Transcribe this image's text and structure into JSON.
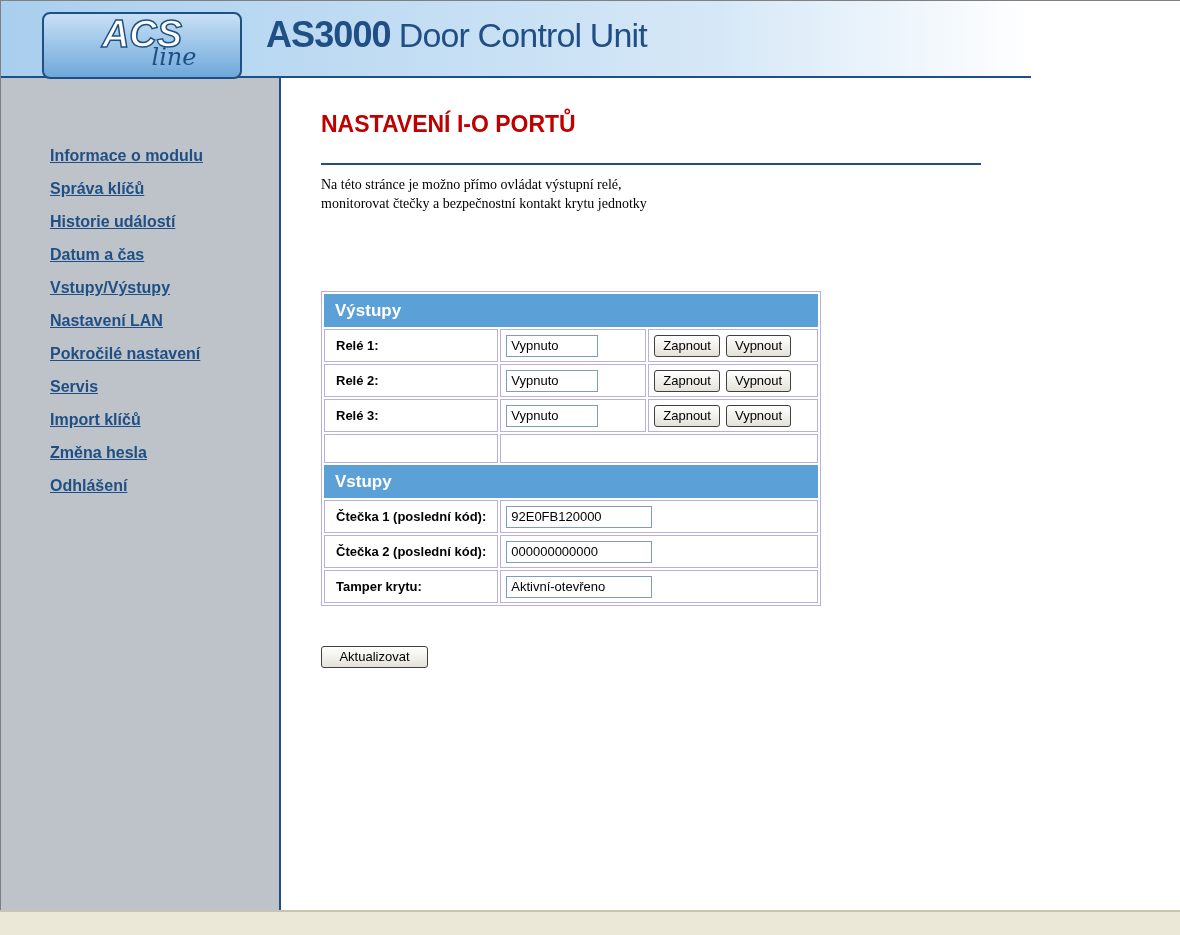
{
  "logo": {
    "main": "ACS",
    "script": "line"
  },
  "header": {
    "model": "AS3000",
    "title": "Door Control Unit"
  },
  "sidebar": {
    "items": [
      {
        "label": "Informace o modulu"
      },
      {
        "label": "Správa klíčů"
      },
      {
        "label": "Historie událostí"
      },
      {
        "label": "Datum a čas"
      },
      {
        "label": "Vstupy/Výstupy"
      },
      {
        "label": "Nastavení LAN"
      },
      {
        "label": "Pokročilé nastavení"
      },
      {
        "label": "Servis"
      },
      {
        "label": "Import klíčů"
      },
      {
        "label": "Změna hesla"
      },
      {
        "label": "Odhlášení"
      }
    ]
  },
  "page": {
    "heading": "NASTAVENÍ I-O PORTŮ",
    "intro": [
      "Na této stránce je možno přímo ovládat výstupní relé,",
      "monitorovat čtečky a bezpečnostní kontakt krytu jednotky"
    ]
  },
  "outputs": {
    "title": "Výstupy",
    "rows": [
      {
        "label": "Relé 1:",
        "value": "Vypnuto",
        "buttons": [
          "Zapnout",
          "Vypnout"
        ]
      },
      {
        "label": "Relé 2:",
        "value": "Vypnuto",
        "buttons": [
          "Zapnout",
          "Vypnout"
        ]
      },
      {
        "label": "Relé 3:",
        "value": "Vypnuto",
        "buttons": [
          "Zapnout",
          "Vypnout"
        ]
      }
    ]
  },
  "inputs": {
    "title": "Vstupy",
    "rows": [
      {
        "label": "Čtečka 1 (poslední kód):",
        "value": "92E0FB120000"
      },
      {
        "label": "Čtečka 2 (poslední kód):",
        "value": "000000000000"
      },
      {
        "label": "Tamper krytu:",
        "value": "Aktivní-otevřeno"
      }
    ]
  },
  "refresh_button": "Aktualizovat"
}
